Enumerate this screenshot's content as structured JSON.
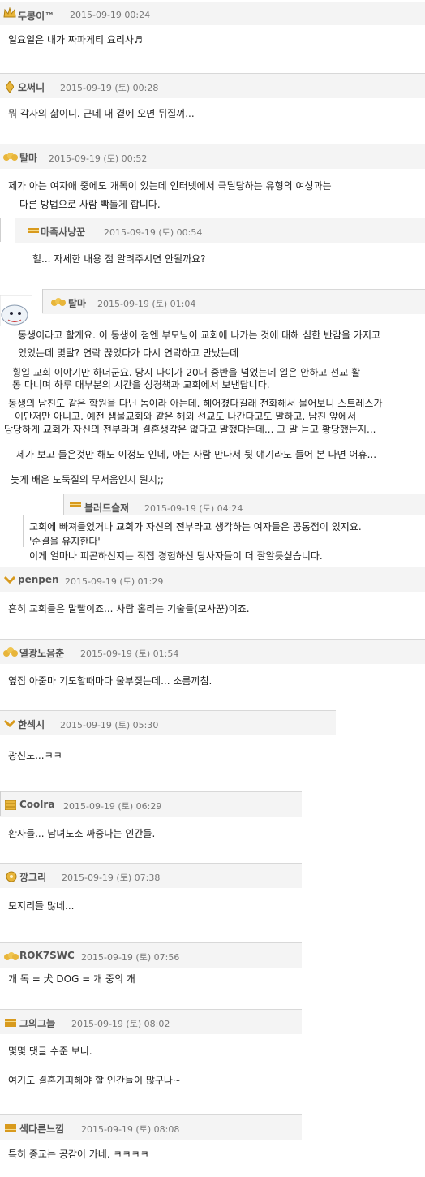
{
  "comments": [
    {
      "author": "두콩이™",
      "date": "2015-09-19 00:24",
      "lines": [
        "일요일은 내가 짜파게티 요리사♬"
      ]
    },
    {
      "author": "오써니",
      "date": "2015-09-19 (토) 00:28",
      "lines": [
        "뭐 각자의 삶이니. 근데 내 곁에 오면 뒤질껴..."
      ]
    },
    {
      "author": "탈마",
      "date": "2015-09-19 (토) 00:52",
      "lines": [
        "제가 아는 여자애 중에도 개독이 있는데 인터넷에서 극딜당하는 유형의 여성과는",
        "다른 방법으로 사람 빡돌게 합니다."
      ]
    },
    {
      "author": "마족사냥꾼",
      "date": "2015-09-19 (토) 00:54",
      "lines": [
        "헐...      자세한 내용 점   알려주시면 안될까요?"
      ]
    },
    {
      "author": "탈마",
      "date": "2015-09-19 (토) 01:04",
      "lines": [
        "동생이라고 할게요. 이 동생이 첨엔 부모님이 교회에 나가는 것에 대해 심한 반감을 가지고",
        "있었는데 몇달? 연락 끊었다가 다시 연락하고 만났는데",
        "휭일 교회 이야기만 하더군요. 당시 나이가 20대 중반을 넘었는데 일은 안하고 선교 활",
        "동 다니며 하루 대부분의 시간을 성경책과 교회에서 보낸답니다.",
        "동생의 남친도 같은 학원을 다닌 놈이라 아는데. 헤어졌다길래 전화해서 물어보니  스트레스가",
        "이만저만 아니고. 예전   샘물교회와 같은 해외 선교도 나간다고도 말하고. 남친 앞에서",
        "당당하게 교회가 자신의 전부라며 결혼생각은 없다고 말했다는데... 그 말 듣고 황당했는지...",
        "제가 보고 들은것만 해도 이정도 인데, 아는 사람 만나서 뒷 얘기라도 들어 본 다면 어휴...",
        "늦게 배운 도둑질의 무서움인지 뭔지;;"
      ]
    },
    {
      "author": "블러드슬져",
      "date": "2015-09-19 (토) 04:24",
      "lines": [
        "교회에 빠져들었거나 교회가 자신의 전부라고 생각하는 여자들은 공통점이 있지요.",
        "'순결을 유지한다'",
        "이게 얼마나 피곤하신지는 직접 경험하신 당사자들이 더 잘알듯싶습니다."
      ]
    },
    {
      "author": "penpen",
      "date": "2015-09-19 (토) 01:29",
      "lines": [
        "흔히 교회들은 말빨이죠... 사람 홀리는 기술들(모사꾼)이죠."
      ]
    },
    {
      "author": "열광노음춘",
      "date": "2015-09-19 (토) 01:54",
      "lines": [
        "옆집 아줌마 기도할때마다 울부짖는데... 소름끼침."
      ]
    },
    {
      "author": "한섹시",
      "date": "2015-09-19 (토) 05:30",
      "lines": [
        "광신도...ㅋㅋ"
      ]
    },
    {
      "author": "Coolra",
      "date": "2015-09-19 (토) 06:29",
      "lines": [
        "환자들... 남녀노소 짜증나는 인간들."
      ]
    },
    {
      "author": "깡그리",
      "date": "2015-09-19 (토) 07:38",
      "lines": [
        "모지리들 많네..."
      ]
    },
    {
      "author": "ROK7SWC",
      "date": "2015-09-19 (토) 07:56",
      "lines": [
        "개 독 = 犬 DOG = 개 중의 개"
      ]
    },
    {
      "author": "그의그늘",
      "date": "2015-09-19 (토) 08:02",
      "lines": [
        "몇몇 댓글 수준 보니.",
        "여기도 결혼기피해야 할 인간들이 많구나~"
      ]
    },
    {
      "author": "색다른느낌",
      "date": "2015-09-19 (토) 08:08",
      "lines": [
        "특히 종교는 공감이 가네. ㅋㅋㅋㅋ"
      ]
    }
  ],
  "colors": {
    "header_bg": "#f4f4f4",
    "border": "#d8d8d8",
    "level_gold": "#e8b53a",
    "level_stripe": "#d89a1d"
  },
  "icons": [
    "crown-level-icon",
    "diamond-level-icon",
    "stripe-level-icon",
    "chevron-level-icon",
    "book-level-icon",
    "cartoon-avatar-icon"
  ]
}
